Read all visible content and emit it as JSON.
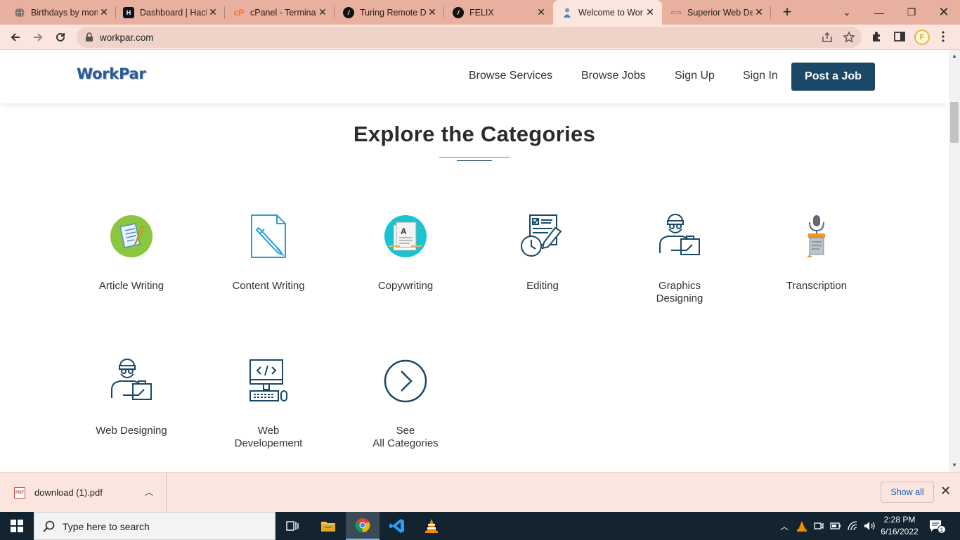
{
  "browser": {
    "tabs": [
      {
        "title": "Birthdays by mon",
        "favicon": "globe-icon",
        "active": false
      },
      {
        "title": "Dashboard | Hack",
        "favicon": "hackerrank-icon",
        "active": false
      },
      {
        "title": "cPanel - Terminal",
        "favicon": "cpanel-icon",
        "active": false
      },
      {
        "title": "Turing Remote D",
        "favicon": "turing-icon",
        "active": false
      },
      {
        "title": "FELIX",
        "favicon": "turing-icon",
        "active": false
      },
      {
        "title": "Welcome to Wor",
        "favicon": "workpar-icon",
        "active": true
      },
      {
        "title": "Superior Web De",
        "favicon": "site-icon",
        "active": false
      }
    ],
    "url": "workpar.com",
    "profile_initial": "F"
  },
  "site": {
    "logo": "WorkPar",
    "nav": {
      "browse_services": "Browse Services",
      "browse_jobs": "Browse Jobs",
      "sign_up": "Sign Up",
      "sign_in": "Sign In",
      "post_job": "Post a Job"
    },
    "section_title": "Explore the Categories",
    "categories": [
      {
        "label": "Article Writing",
        "icon": "article-writing-icon"
      },
      {
        "label": "Content Writing",
        "icon": "content-writing-icon"
      },
      {
        "label": "Copywriting",
        "icon": "copywriting-icon"
      },
      {
        "label": "Editing",
        "icon": "editing-icon"
      },
      {
        "label": "Graphics Designing",
        "icon": "graphics-designing-icon"
      },
      {
        "label": "Transcription",
        "icon": "transcription-icon"
      },
      {
        "label": "Web Designing",
        "icon": "web-designing-icon"
      },
      {
        "label": "Web Developement",
        "icon": "web-development-icon"
      },
      {
        "label": "See All Categories",
        "icon": "chevron-right-circle-icon"
      }
    ]
  },
  "downloads": {
    "file_name": "download (1).pdf",
    "file_badge": "PDF",
    "show_all": "Show all"
  },
  "taskbar": {
    "search_placeholder": "Type here to search",
    "time": "2:28 PM",
    "date": "6/16/2022",
    "notification_count": "1"
  },
  "colors": {
    "brand_dark": "#1b4866",
    "icon_stroke": "#1b4866",
    "accent_blue": "#3a84b5",
    "chrome_tabbar": "#e8b09f",
    "chrome_toolbar": "#fbe6df"
  }
}
